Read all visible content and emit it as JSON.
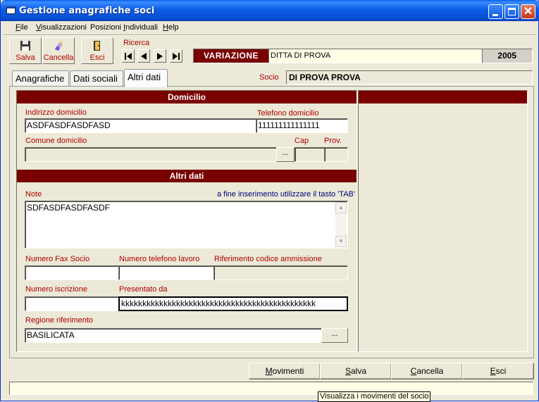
{
  "window": {
    "title": "Gestione anagrafiche soci"
  },
  "menu": [
    {
      "label": "File",
      "accel": "F"
    },
    {
      "label": "Visualizzazioni",
      "accel": "V"
    },
    {
      "label": "Posizioni Individuali",
      "accel": "I"
    },
    {
      "label": "Help",
      "accel": "H"
    }
  ],
  "toolbar": {
    "salva": "Salva",
    "cancella": "Cancella",
    "esci": "Esci",
    "ricerca": "Ricerca"
  },
  "status": {
    "mode": "VARIAZIONE",
    "ditta": "DITTA DI PROVA",
    "anno": "2005"
  },
  "tabs": [
    "Anagrafiche",
    "Dati sociali",
    "Altri dati"
  ],
  "active_tab": "Altri dati",
  "socio": {
    "label": "Socio",
    "value": "DI PROVA PROVA"
  },
  "domicilio": {
    "header": "Domicilio",
    "indirizzo_label": "Indirizzo domicilio",
    "indirizzo_value": "ASDFASDFASDFASD",
    "telefono_label": "Telefono domicilio",
    "telefono_value": "111111111111111",
    "comune_label": "Comune domicilio",
    "comune_value": "",
    "cap_label": "Cap",
    "prov_label": "Prov.",
    "ellipsis": "..."
  },
  "altri_dati": {
    "header": "Altri dati",
    "note_label": "Note",
    "note_hint": "a fine inserimento utilizzare il tasto 'TAB'",
    "note_value": "SDFASDFASDFASDF",
    "fax_label": "Numero Fax Socio",
    "fax_value": "",
    "tel_lavoro_label": "Numero telefono lavoro",
    "tel_lavoro_value": "",
    "rif_label": "Riferimento codice ammissione",
    "rif_value": "",
    "iscrizione_label": "Numero iscrizione",
    "iscrizione_value": "",
    "presentato_label": "Presentato da",
    "presentato_value": "kkkkkkkkkkkkkkkkkkkkkkkkkkkkkkkkkkkkkkkkkkkkkk",
    "regione_label": "Regione riferimento",
    "regione_value": "BASILICATA",
    "ellipsis": "..."
  },
  "actions": {
    "movimenti": "Movimenti",
    "salva": "Salva",
    "cancella": "Cancella",
    "esci": "Esci"
  },
  "tooltip": "Visualizza i movimenti del socio",
  "colors": {
    "titlebar": "#0A5EE9",
    "header_red": "#7A0000",
    "label_red": "#B00000",
    "hint_blue": "#00007A"
  }
}
